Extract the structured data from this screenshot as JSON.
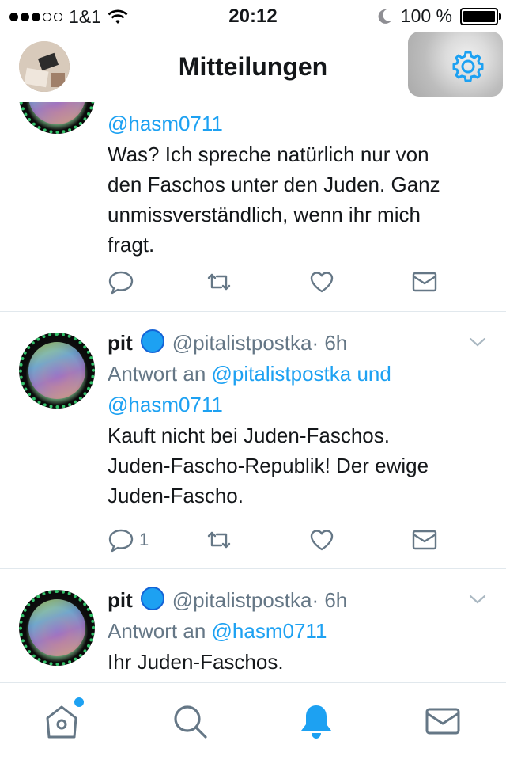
{
  "status_bar": {
    "carrier": "1&1",
    "time": "20:12",
    "battery": "100 %",
    "battery_level": 1.0
  },
  "header": {
    "title": "Mitteilungen"
  },
  "tweets": [
    {
      "reply_tail": "@hasm0711",
      "text_lines": [
        "Was? Ich spreche natürlich nur von",
        "den Faschos unter den Juden. Ganz",
        "unmissverständlich, wenn ihr mich",
        "fragt."
      ],
      "reply_count": ""
    },
    {
      "name": "pit",
      "handle": "@pitalistpostka",
      "time": "· 6h",
      "reply_prefix": "Antwort an ",
      "reply_to_1": "@pitalistpostka",
      "reply_and": " und",
      "reply_to_2": "@hasm0711",
      "text_lines": [
        "Kauft nicht bei Juden-Faschos.",
        "Juden-Fascho-Republik! Der ewige",
        "Juden-Fascho."
      ],
      "reply_count": "1"
    },
    {
      "name": "pit",
      "handle": "@pitalistpostka",
      "time": "· 6h",
      "reply_prefix": "Antwort an ",
      "reply_to_1": "@hasm0711",
      "text_lines": [
        "Ihr Juden-Faschos."
      ]
    }
  ],
  "tabs": [
    {
      "icon": "home-icon",
      "has_badge": true
    },
    {
      "icon": "search-icon"
    },
    {
      "icon": "bell-icon",
      "active": true
    },
    {
      "icon": "mail-icon"
    }
  ],
  "colors": {
    "accent": "#1da1f2",
    "text": "#14171a",
    "muted": "#657786",
    "divider": "#e1e8ed"
  }
}
